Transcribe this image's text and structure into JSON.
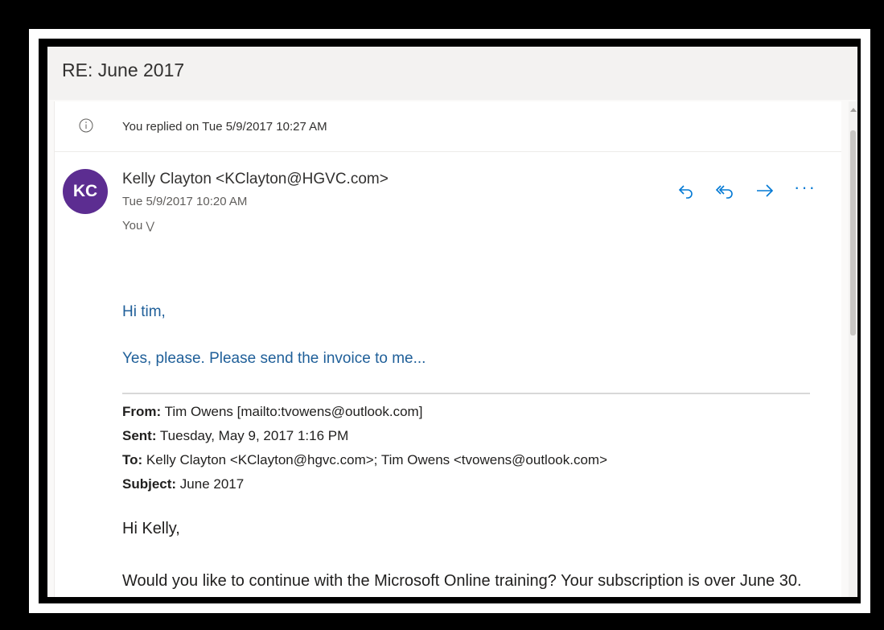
{
  "email": {
    "subject": "RE: June 2017",
    "reply_notice": "You replied on Tue 5/9/2017 10:27 AM",
    "sender": "Kelly Clayton <KClayton@HGVC.com>",
    "avatar_initials": "KC",
    "avatar_color": "#5c2d91",
    "date": "Tue 5/9/2017 10:20 AM",
    "to": "You",
    "body": {
      "greeting": "Hi tim,",
      "text": "Yes, please.  Please send the invoice to me..."
    },
    "quoted": {
      "from_label": "From:",
      "from_value": "Tim Owens [mailto:tvowens@outlook.com]",
      "sent_label": "Sent:",
      "sent_value": "Tuesday, May 9, 2017 1:16 PM",
      "to_label": "To:",
      "to_value": "Kelly Clayton <KClayton@hgvc.com>; Tim Owens <tvowens@outlook.com>",
      "subject_label": "Subject:",
      "subject_value": "June 2017",
      "greeting": "Hi Kelly,",
      "paragraph": "Would you like to continue with the Microsoft Online training? Your subscription is over June 30."
    }
  },
  "actions": [
    {
      "name": "reply",
      "icon": "reply-icon"
    },
    {
      "name": "reply-all",
      "icon": "reply-all-icon"
    },
    {
      "name": "forward",
      "icon": "forward-arrow-icon"
    },
    {
      "name": "more",
      "icon": "more-actions-icon"
    }
  ],
  "colors": {
    "accent": "#0078d4",
    "body_text": "#1f5f99"
  }
}
